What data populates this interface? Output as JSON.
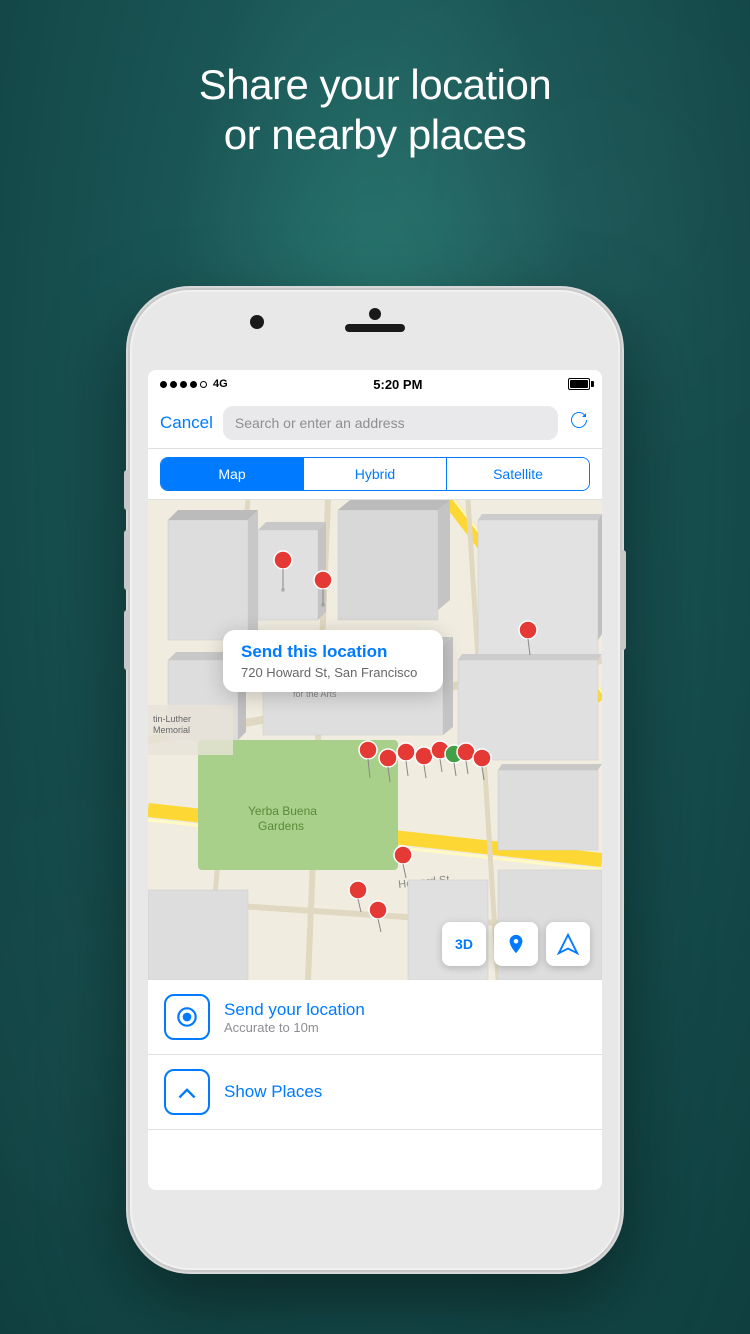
{
  "background": {
    "color": "#1a5f5f"
  },
  "headline": {
    "line1": "Share your location",
    "line2": "or nearby places"
  },
  "status_bar": {
    "signal_bars": 4,
    "network": "4G",
    "time": "5:20 PM",
    "battery_full": true
  },
  "search": {
    "cancel_label": "Cancel",
    "placeholder": "Search or enter an address"
  },
  "map_type": {
    "options": [
      "Map",
      "Hybrid",
      "Satellite"
    ],
    "active": 0
  },
  "map": {
    "popup_title": "Send this location",
    "popup_address": "720 Howard St, San Francisco",
    "map_labels": [
      "Yerba Buena Gardens",
      "Yerba Buena Centre\nfor the Arts",
      "tin-Luther\nMemorial",
      "Howard St"
    ],
    "ctrl_3d": "3D"
  },
  "bottom_items": [
    {
      "id": "send-location",
      "title": "Send your location",
      "subtitle": "Accurate to 10m",
      "icon": "location"
    },
    {
      "id": "show-places",
      "title": "Show Places",
      "subtitle": "",
      "icon": "upload"
    }
  ]
}
